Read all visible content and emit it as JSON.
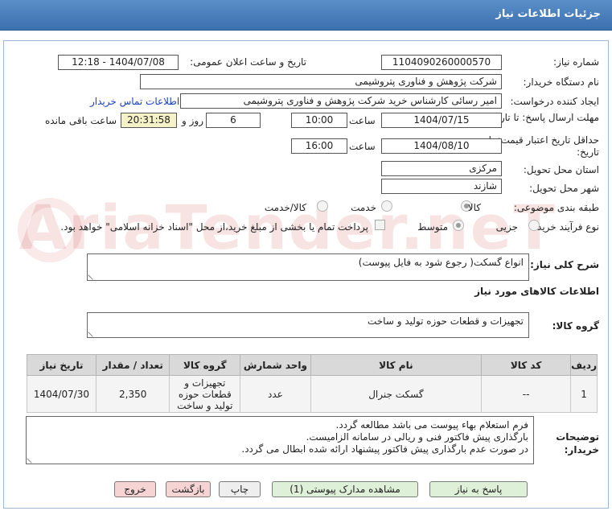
{
  "window": {
    "title": "جزئیات اطلاعات نیاز"
  },
  "form": {
    "need_number": {
      "label": "شماره نیاز:",
      "value": "1104090260000570"
    },
    "announce": {
      "label": "تاریخ و ساعت اعلان عمومی:",
      "value": "1404/07/08 - 12:18"
    },
    "buyer_org": {
      "label": "نام دستگاه خریدار:",
      "value": "شرکت پژوهش و فناوری پتروشیمی"
    },
    "creator": {
      "label": "ایجاد کننده درخواست:",
      "value": "امیر رسائی کارشناس خرید شرکت پژوهش و فناوری پتروشیمی",
      "contact_link": "اطلاعات تماس خریدار"
    },
    "deadline": {
      "label": "مهلت ارسال پاسخ: تا تاریخ:",
      "date": "1404/07/15",
      "time_label": "ساعت",
      "time": "10:00",
      "days": "6",
      "days_label": "روز و",
      "remaining": "20:31:58",
      "remaining_label": "ساعت باقی مانده"
    },
    "validity": {
      "label": "حداقل تاریخ اعتبار قیمت: تا تاریخ:",
      "date": "1404/08/10",
      "time_label": "ساعت",
      "time": "16:00"
    },
    "province": {
      "label": "استان محل تحویل:",
      "value": "مرکزی"
    },
    "city": {
      "label": "شهر محل تحویل:",
      "value": "شازند"
    },
    "category": {
      "label": "طبقه بندی موضوعی:",
      "options": [
        "کالا",
        "خدمت",
        "کالا/خدمت"
      ],
      "selected": "کالا"
    },
    "process": {
      "label": "نوع فرآیند خرید :",
      "options": [
        "جزیی",
        "متوسط"
      ],
      "selected": "متوسط",
      "note": "پرداخت تمام یا بخشی از مبلغ خرید،از محل \"اسناد خزانه اسلامی\" خواهد بود."
    },
    "summary": {
      "label": "شرح کلی نیاز:",
      "value": "انواع گسکت( رجوع شود به فایل پیوست)"
    },
    "goods_info_heading": "اطلاعات کالاهای مورد نیاز",
    "goods_group": {
      "label": "گروه کالا:",
      "value": "تجهیزات و قطعات حوزه تولید و ساخت"
    }
  },
  "table": {
    "headers": [
      "ردیف",
      "کد کالا",
      "نام کالا",
      "واحد شمارش",
      "گروه کالا",
      "تعداد / مقدار",
      "تاریخ نیاز"
    ],
    "rows": [
      [
        "1",
        "--",
        "گسکت جنرال",
        "عدد",
        "تجهیزات و قطعات حوزه تولید و ساخت",
        "2,350",
        "1404/07/30"
      ]
    ]
  },
  "notes": {
    "label": "توضیحات خریدار:",
    "lines": [
      "فرم استعلام بهاء پیوست می باشد مطالعه گردد.",
      "بارگذاری پیش فاکتور فنی و ریالی در سامانه الزامیست.",
      "در صورت عدم بارگذاری پیش فاکتور پیشنهاد ارائه شده ابطال می گردد."
    ]
  },
  "buttons": {
    "reply": "پاسخ به نیاز",
    "attachments": "مشاهده مدارک پیوستی (1)",
    "print": "چاپ",
    "back": "بازگشت",
    "exit": "خروج"
  },
  "watermark": "AriaTender.neT",
  "colors": {
    "titlebar": "#3c6fae",
    "link": "#1a3fc4",
    "timer_bg": "#f6f2c8",
    "btn_green": "#dff0d8",
    "btn_pink": "#f6d4d4"
  }
}
